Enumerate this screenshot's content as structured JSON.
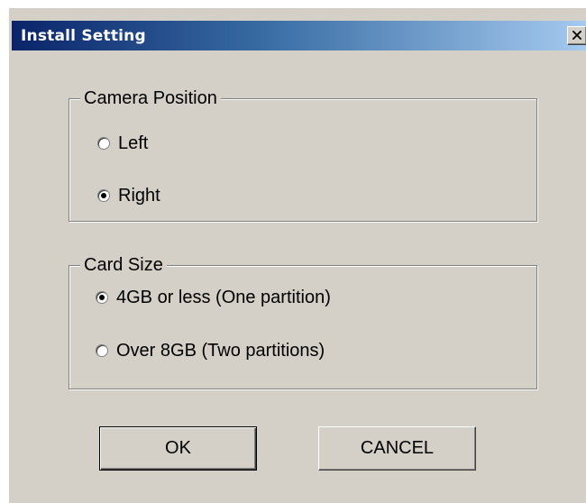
{
  "window": {
    "title": "Install Setting",
    "close_glyph": "×"
  },
  "camera_position": {
    "legend": "Camera Position",
    "options": [
      {
        "label": "Left",
        "checked": false
      },
      {
        "label": "Right",
        "checked": true
      }
    ]
  },
  "card_size": {
    "legend": "Card Size",
    "options": [
      {
        "label": "4GB or less (One partition)",
        "checked": true
      },
      {
        "label": "Over 8GB (Two partitions)",
        "checked": false
      }
    ]
  },
  "buttons": {
    "ok_label": "OK",
    "cancel_label": "CANCEL"
  },
  "colors": {
    "dialog_face": "#d4d0c8",
    "title_gradient_start": "#0a246a",
    "title_gradient_end": "#a6caf0"
  }
}
